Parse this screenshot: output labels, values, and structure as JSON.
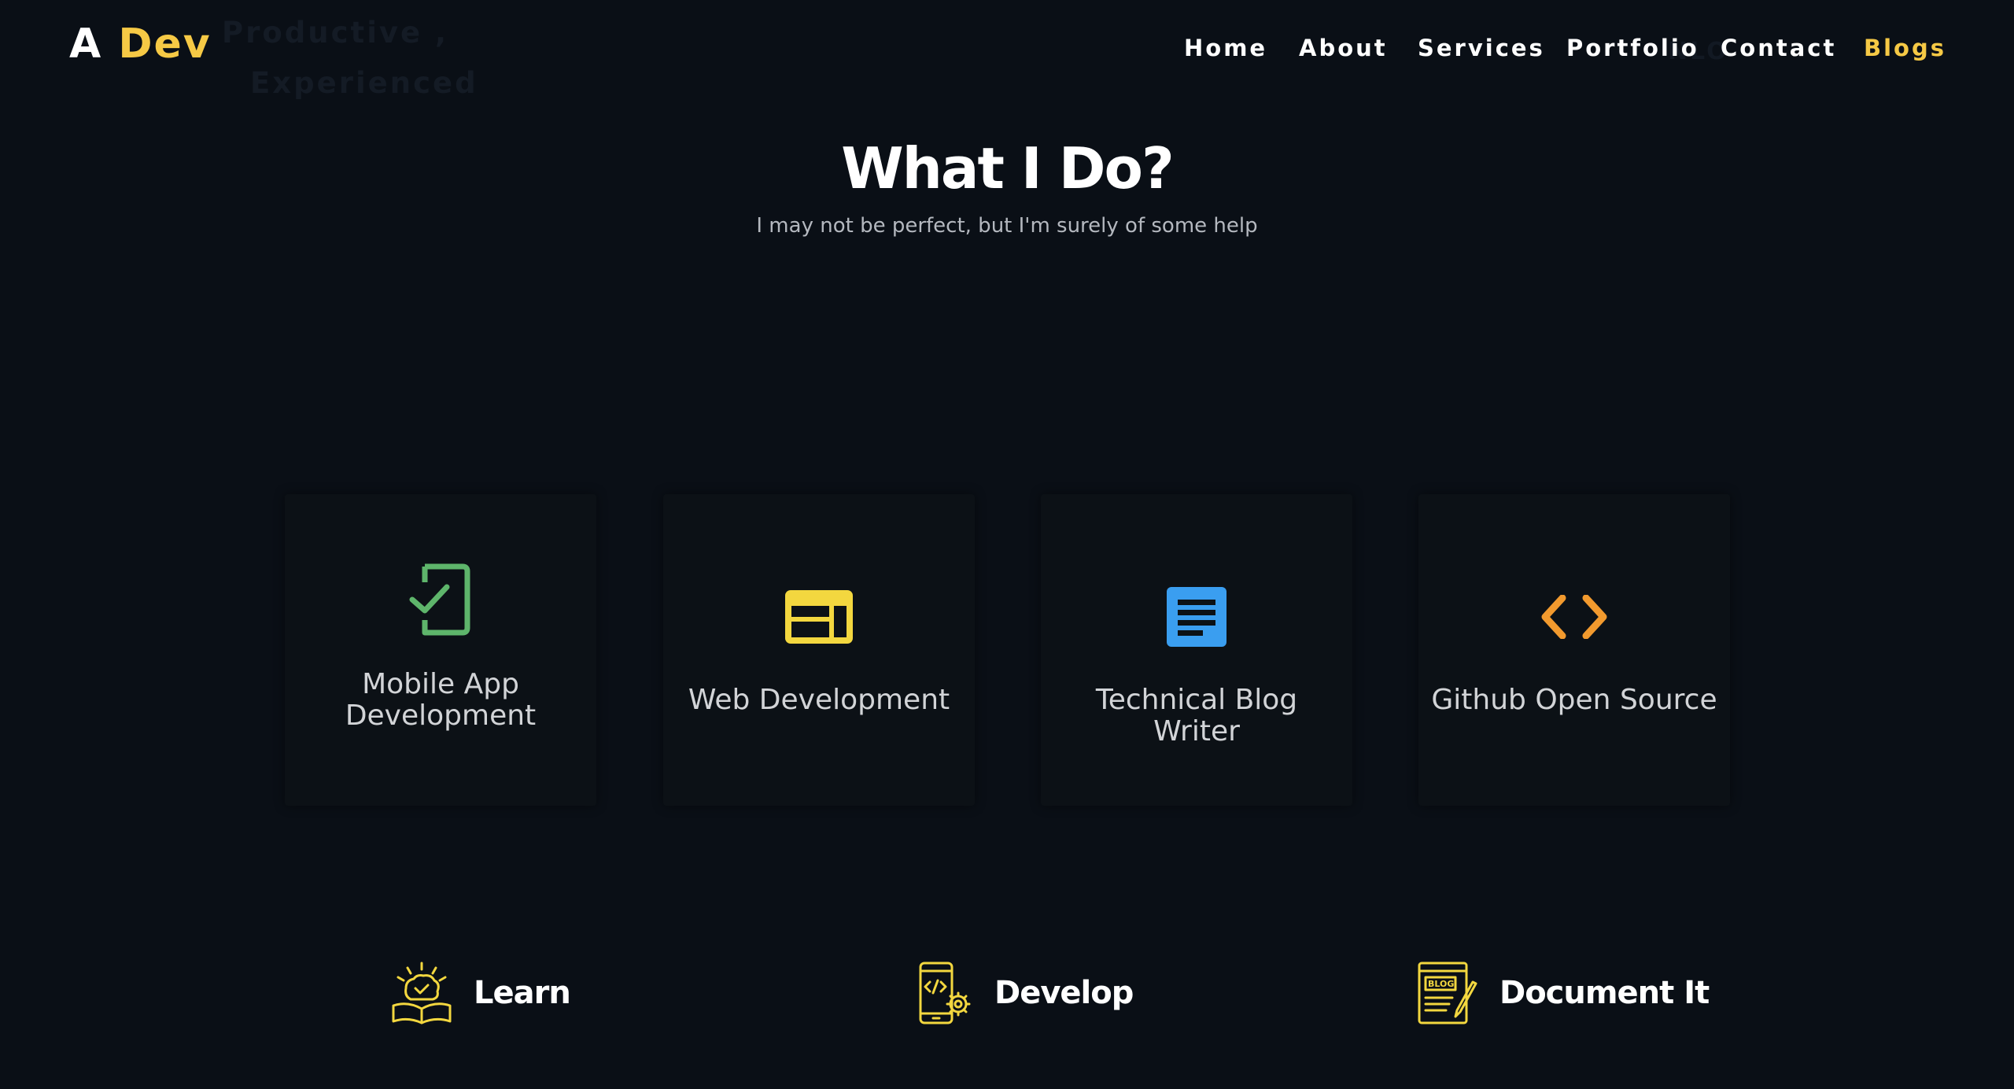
{
  "header": {
    "logo_prefix": "A",
    "logo_accent": "Dev",
    "ghost_line1": "Productive ,",
    "ghost_line2": "Experienced",
    "ghost_right": "NLO",
    "nav": {
      "home": "Home",
      "about": "About",
      "services": "Services",
      "portfolio": "Portfolio",
      "contact": "Contact",
      "blogs": "Blogs"
    }
  },
  "section": {
    "title": "What I Do?",
    "subtitle": "I may not be perfect, but I'm surely of some help"
  },
  "cards": [
    {
      "label": "Mobile App Development",
      "icon": "mobile-check-icon",
      "color": "#5eb56b"
    },
    {
      "label": "Web Development",
      "icon": "web-layout-icon",
      "color": "#f3d73f"
    },
    {
      "label": "Technical Blog Writer",
      "icon": "document-icon",
      "color": "#3a9ef0"
    },
    {
      "label": "Github Open Source",
      "icon": "code-icon",
      "color": "#f29a2e"
    }
  ],
  "features": [
    {
      "label": "Learn",
      "icon": "book-brain-icon"
    },
    {
      "label": "Develop",
      "icon": "mobile-code-gear-icon"
    },
    {
      "label": "Document It",
      "icon": "blog-pen-icon"
    }
  ],
  "colors": {
    "background": "#0a0f16",
    "card": "#0c1116",
    "accent": "#f6c945"
  }
}
